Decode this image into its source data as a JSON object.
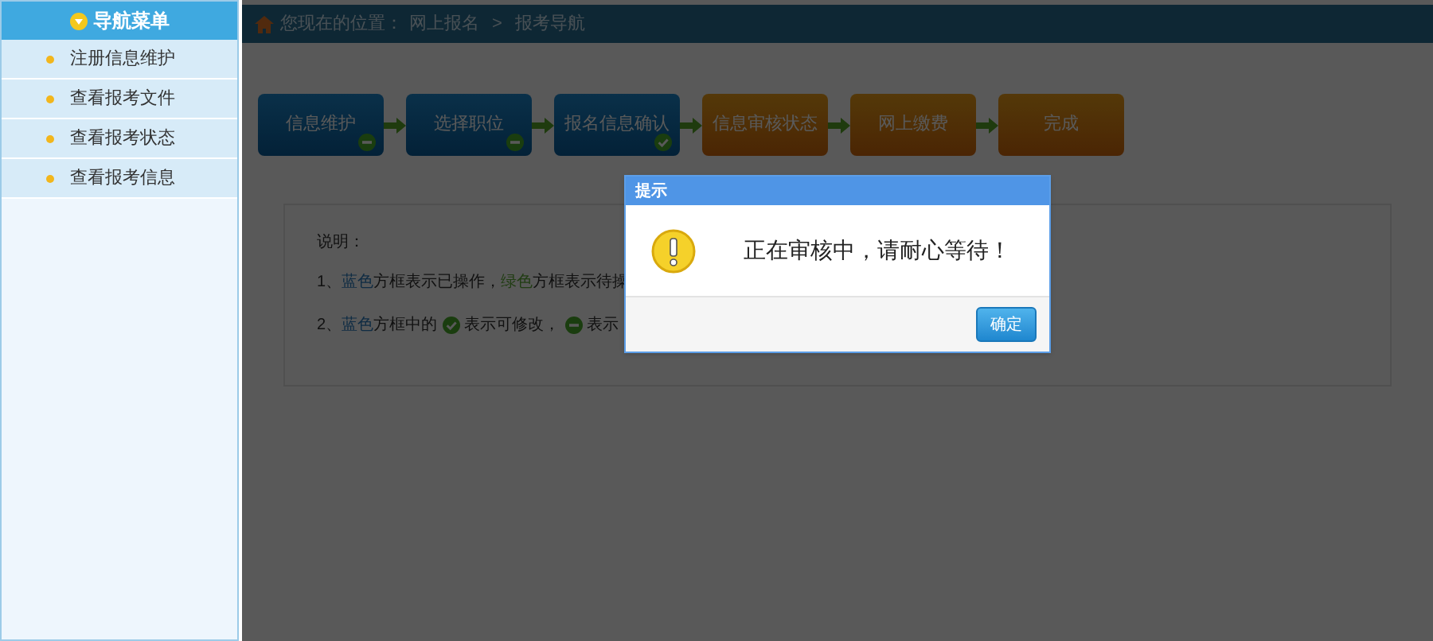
{
  "sidebar": {
    "title": "导航菜单",
    "items": [
      {
        "label": "注册信息维护"
      },
      {
        "label": "查看报考文件"
      },
      {
        "label": "查看报考状态"
      },
      {
        "label": "查看报考信息"
      }
    ]
  },
  "breadcrumb": {
    "prefix": "您现在的位置：",
    "items": [
      "网上报名",
      "报考导航"
    ],
    "separator": ">"
  },
  "steps": [
    {
      "label": "信息维护",
      "kind": "done",
      "editable": false
    },
    {
      "label": "选择职位",
      "kind": "done",
      "editable": false
    },
    {
      "label": "报名信息确认",
      "kind": "done",
      "editable": true
    },
    {
      "label": "信息审核状态",
      "kind": "pending"
    },
    {
      "label": "网上缴费",
      "kind": "pending"
    },
    {
      "label": "完成",
      "kind": "pending"
    }
  ],
  "notes": {
    "title": "说明：",
    "lines": [
      [
        {
          "kind": "text",
          "text": "1、"
        },
        {
          "kind": "done",
          "text": "蓝色"
        },
        {
          "kind": "text",
          "text": "方框表示已操作，"
        },
        {
          "kind": "todo",
          "text": "绿色"
        },
        {
          "kind": "text",
          "text": "方框表示待操"
        }
      ],
      [
        {
          "kind": "text",
          "text": "2、"
        },
        {
          "kind": "done",
          "text": "蓝色"
        },
        {
          "kind": "text",
          "text": "方框中的"
        },
        {
          "kind": "check"
        },
        {
          "kind": "text",
          "text": "表示可修改，"
        },
        {
          "kind": "minus"
        },
        {
          "kind": "text",
          "text": "表示"
        }
      ]
    ]
  },
  "dialog": {
    "title": "提示",
    "message": "正在审核中，请耐心等待！",
    "buttons": [
      "确定"
    ]
  }
}
